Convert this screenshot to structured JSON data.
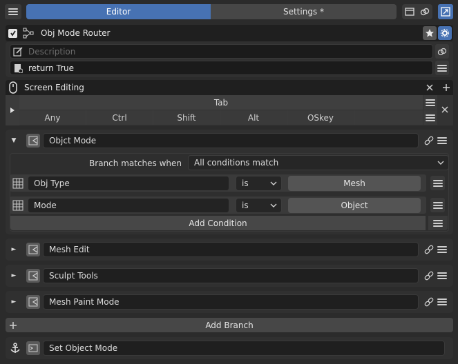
{
  "tabs": {
    "editor": "Editor",
    "settings": "Settings *"
  },
  "router": {
    "title": "Obj Mode Router",
    "description_placeholder": "Description",
    "return_code": "return True"
  },
  "hotkey": {
    "label": "Screen Editing",
    "key": "Tab",
    "modifiers": [
      "Any",
      "Ctrl",
      "Shift",
      "Alt",
      "OSkey"
    ]
  },
  "branches": [
    {
      "name": "Objct Mode",
      "expanded": true
    },
    {
      "name": "Mesh Edit",
      "expanded": false
    },
    {
      "name": "Sculpt Tools",
      "expanded": false
    },
    {
      "name": "Mesh Paint Mode",
      "expanded": false
    }
  ],
  "objct_mode": {
    "match_label": "Branch matches when",
    "match_value": "All conditions match",
    "conditions": [
      {
        "property": "Obj Type",
        "operator": "is",
        "value": "Mesh"
      },
      {
        "property": "Mode",
        "operator": "is",
        "value": "Object"
      }
    ],
    "add_condition": "Add Condition"
  },
  "add_branch": "Add Branch",
  "action": {
    "label": "Set Object Mode"
  },
  "colors": {
    "accent": "#4772b3",
    "background": "#2b2b2b",
    "panel": "#303030",
    "field": "#1e1e1e"
  },
  "icons": [
    "menu-icon",
    "window-icon",
    "link-icon",
    "expand-icon",
    "checkbox-icon",
    "node-tree-icon",
    "star-icon",
    "gear-icon",
    "edit-icon",
    "python-icon",
    "script-icon",
    "mouse-icon",
    "close-icon",
    "plus-icon",
    "chain-icon",
    "grid-icon",
    "anchor-icon",
    "console-icon"
  ]
}
